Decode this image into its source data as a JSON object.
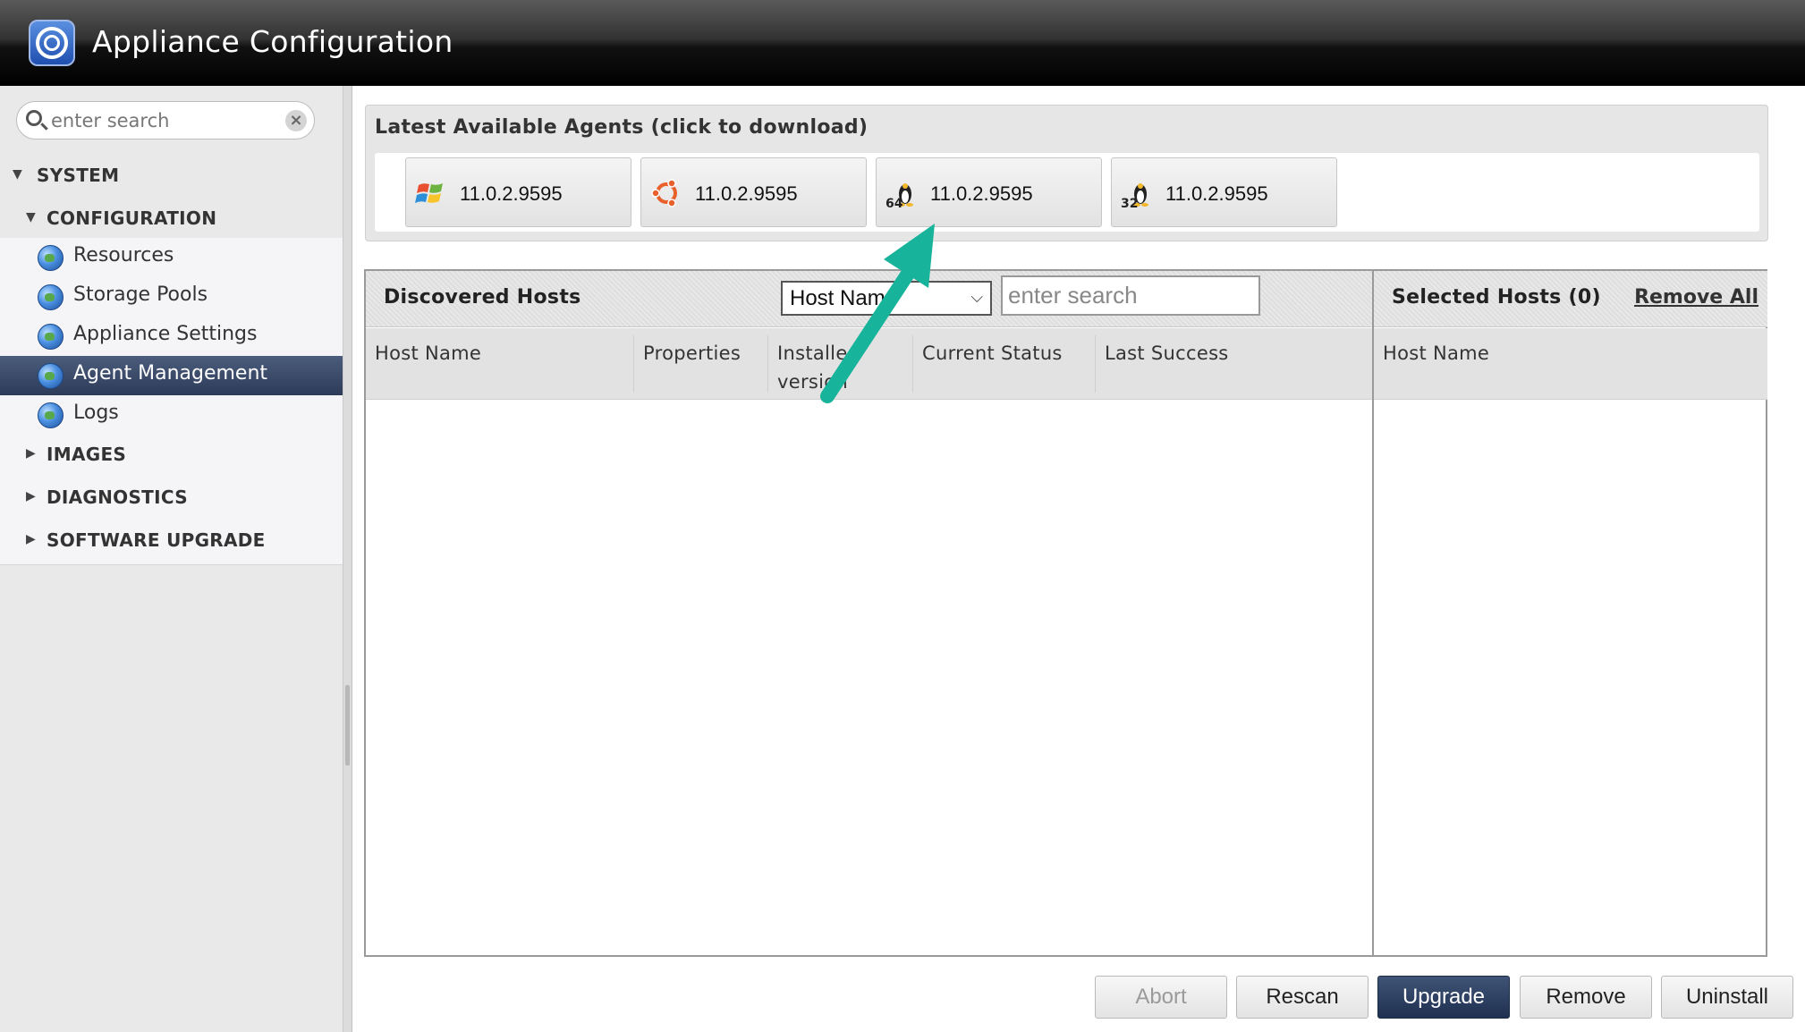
{
  "app": {
    "title": "Appliance Configuration"
  },
  "sidebar": {
    "search_placeholder": "enter search",
    "clear_glyph": "×",
    "system_label": "SYSTEM",
    "configuration_label": "CONFIGURATION",
    "items": [
      {
        "label": "Resources",
        "icon": "globe-icon",
        "active": false
      },
      {
        "label": "Storage Pools",
        "icon": "globe-icon",
        "active": false
      },
      {
        "label": "Appliance Settings",
        "icon": "globe-icon",
        "active": false
      },
      {
        "label": "Agent Management",
        "icon": "globe-icon",
        "active": true
      },
      {
        "label": "Logs",
        "icon": "globe-icon",
        "active": false
      }
    ],
    "sections_collapsed": [
      "IMAGES",
      "DIAGNOSTICS",
      "SOFTWARE UPGRADE"
    ]
  },
  "agents": {
    "title": "Latest Available Agents (click to download)",
    "items": [
      {
        "version": "11.0.2.9595",
        "icon": "windows-icon"
      },
      {
        "version": "11.0.2.9595",
        "icon": "ubuntu-icon"
      },
      {
        "version": "11.0.2.9595",
        "icon": "linux-64-icon",
        "badge": "64"
      },
      {
        "version": "11.0.2.9595",
        "icon": "linux-32-icon",
        "badge": "32"
      }
    ]
  },
  "discovered": {
    "title": "Discovered Hosts",
    "filter_value": "Host Name",
    "search_placeholder": "enter search",
    "columns": [
      "Host Name",
      "Properties",
      "Installed version",
      "Current Status",
      "Last Success"
    ]
  },
  "selected": {
    "title": "Selected Hosts (0)",
    "remove_all": "Remove All",
    "columns": [
      "Host Name"
    ]
  },
  "footer": {
    "abort": "Abort",
    "rescan": "Rescan",
    "upgrade": "Upgrade",
    "remove": "Remove",
    "uninstall": "Uninstall"
  },
  "colors": {
    "header_bg": "#1a1a1a",
    "active_nav": "#34435f",
    "primary_button": "#2b3c5c",
    "annotation_arrow": "#17b39a"
  }
}
